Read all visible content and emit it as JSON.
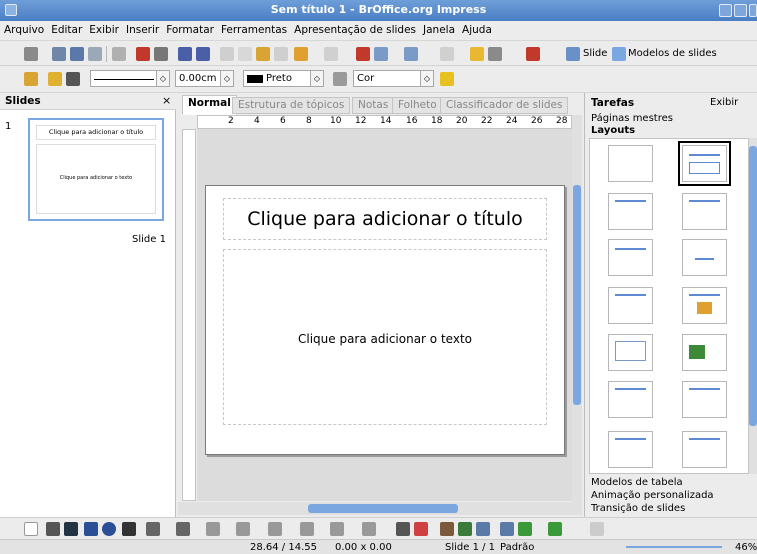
{
  "window": {
    "title": "Sem título 1 - BrOffice.org Impress"
  },
  "menu": [
    "Arquivo",
    "Editar",
    "Exibir",
    "Inserir",
    "Formatar",
    "Ferramentas",
    "Apresentação de slides",
    "Janela",
    "Ajuda"
  ],
  "toolbar": {
    "slide_label": "Slide",
    "models_label": "Modelos de slides"
  },
  "format_bar": {
    "line_width": "0.00cm",
    "line_color": "Preto",
    "fill_type": "Cor"
  },
  "slides_panel": {
    "title": "Slides",
    "close": "×",
    "slide_number": "1",
    "thumb_title": "Clique para adicionar o título",
    "thumb_text": "Clique para adicionar o texto",
    "slide_caption": "Slide 1"
  },
  "tabs": [
    "Normal",
    "Estrutura de tópicos",
    "Notas",
    "Folheto",
    "Classificador de slides"
  ],
  "ruler_numbers": [
    "2",
    "4",
    "6",
    "8",
    "10",
    "12",
    "14",
    "16",
    "18",
    "20",
    "22",
    "24",
    "26",
    "28"
  ],
  "slide": {
    "title_placeholder": "Clique para adicionar o título",
    "text_placeholder": "Clique para adicionar o texto"
  },
  "tasks": {
    "title": "Tarefas",
    "view": "Exibir",
    "sections": [
      "Páginas mestres",
      "Layouts",
      "Modelos de tabela",
      "Animação personalizada",
      "Transição de slides"
    ]
  },
  "status": {
    "position": "28.64 / 14.55",
    "size": "0.00 x 0.00",
    "slide": "Slide 1 / 1",
    "master": "Padrão",
    "zoom": "46%"
  },
  "colors": {
    "titlebar": "#4a7ec4",
    "selection": "#7aa7e0"
  }
}
